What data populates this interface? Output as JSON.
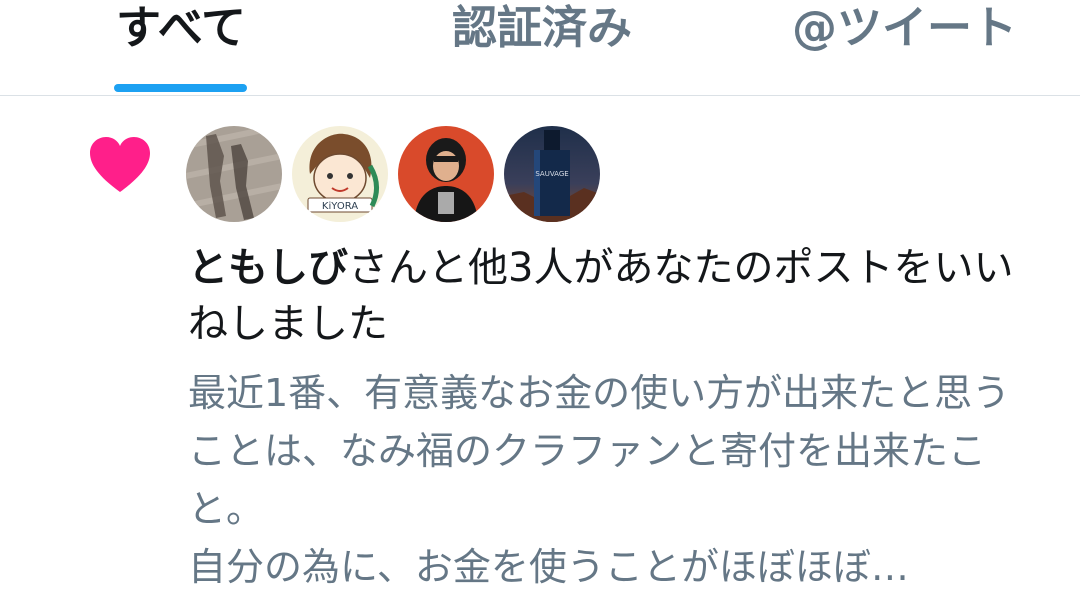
{
  "tabs": [
    {
      "label": "すべて",
      "active": true
    },
    {
      "label": "認証済み",
      "active": false
    },
    {
      "label": "@ツイート",
      "active": false
    }
  ],
  "notification": {
    "type_icon": "heart-icon",
    "icon_color": "#e0245e",
    "username": "ともしび",
    "action_text": "さんと他3人があなたのポストをいいねしました",
    "snippet": "最近1番、有意義なお金の使い方が出来たと思うことは、なみ福のクラファンと寄付を出来たこと。\n自分の為に、お金を使うことがほぼほぼ…",
    "avatars": [
      {
        "name": "ともしび",
        "icon": "shadow-photo-avatar"
      },
      {
        "name": "KIYORA",
        "label": "KiYORA",
        "icon": "illustrated-face-avatar"
      },
      {
        "name": "user3",
        "icon": "person-photo-avatar"
      },
      {
        "name": "user4",
        "icon": "perfume-bottle-avatar",
        "label": "SAUVAGE"
      }
    ]
  },
  "colors": {
    "accent": "#1da1f2",
    "primary_text": "#14171a",
    "secondary_text": "#657786"
  }
}
